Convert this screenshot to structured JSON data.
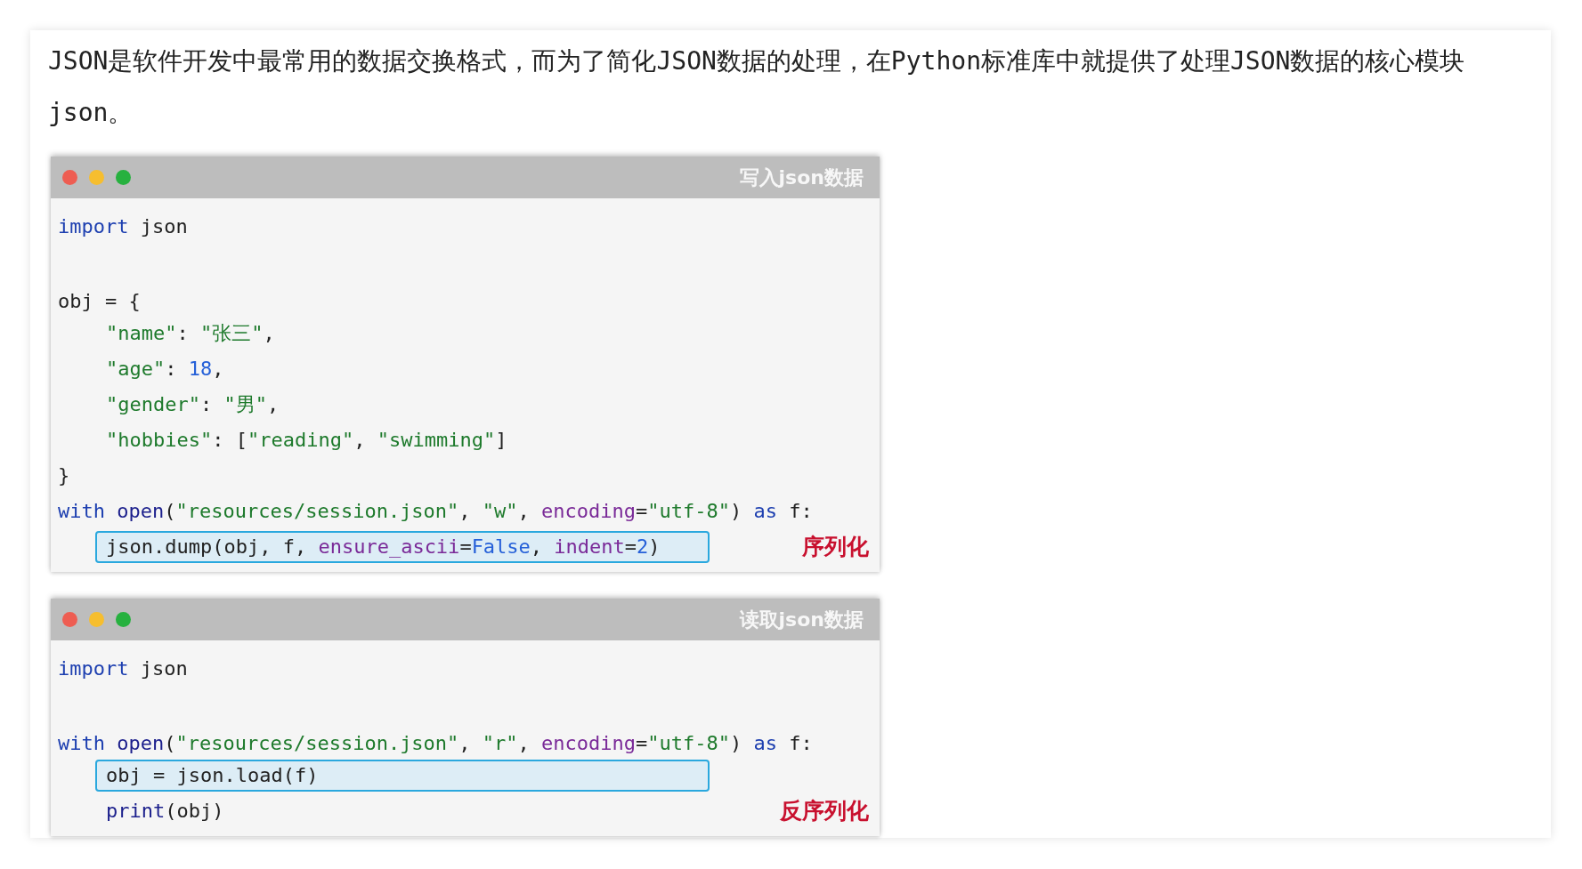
{
  "intro": "JSON是软件开发中最常用的数据交换格式，而为了简化JSON数据的处理，在Python标准库中就提供了处理JSON数据的核心模块 json。",
  "windows": [
    {
      "title": "写入json数据",
      "annotation": "序列化",
      "lines": [
        {
          "tokens": [
            {
              "t": "import",
              "kind": "kw"
            },
            {
              "t": " json",
              "kind": "plain"
            }
          ]
        },
        {
          "blank_before": true,
          "tokens": [
            {
              "t": "obj = {",
              "kind": "plain"
            }
          ]
        },
        {
          "indented": true,
          "tokens": [
            {
              "t": "\"name\"",
              "kind": "str"
            },
            {
              "t": ": ",
              "kind": "plain"
            },
            {
              "t": "\"张三\"",
              "kind": "str"
            },
            {
              "t": ",",
              "kind": "plain"
            }
          ]
        },
        {
          "indented": true,
          "tokens": [
            {
              "t": "\"age\"",
              "kind": "str"
            },
            {
              "t": ": ",
              "kind": "plain"
            },
            {
              "t": "18",
              "kind": "num"
            },
            {
              "t": ",",
              "kind": "plain"
            }
          ]
        },
        {
          "indented": true,
          "tokens": [
            {
              "t": "\"gender\"",
              "kind": "str"
            },
            {
              "t": ": ",
              "kind": "plain"
            },
            {
              "t": "\"男\"",
              "kind": "str"
            },
            {
              "t": ",",
              "kind": "plain"
            }
          ]
        },
        {
          "indented": true,
          "tokens": [
            {
              "t": "\"hobbies\"",
              "kind": "str"
            },
            {
              "t": ": [",
              "kind": "plain"
            },
            {
              "t": "\"reading\"",
              "kind": "str"
            },
            {
              "t": ", ",
              "kind": "plain"
            },
            {
              "t": "\"swimming\"",
              "kind": "str"
            },
            {
              "t": "]",
              "kind": "plain"
            }
          ]
        },
        {
          "tokens": [
            {
              "t": "}",
              "kind": "plain"
            }
          ]
        },
        {
          "tokens": [
            {
              "t": "with",
              "kind": "kw"
            },
            {
              "t": " open",
              "kind": "fn"
            },
            {
              "t": "(",
              "kind": "plain"
            },
            {
              "t": "\"resources/session.json\"",
              "kind": "str"
            },
            {
              "t": ", ",
              "kind": "plain"
            },
            {
              "t": "\"w\"",
              "kind": "str"
            },
            {
              "t": ", ",
              "kind": "plain"
            },
            {
              "t": "encoding",
              "kind": "param"
            },
            {
              "t": "=",
              "kind": "plain"
            },
            {
              "t": "\"utf-8\"",
              "kind": "str"
            },
            {
              "t": ") ",
              "kind": "plain"
            },
            {
              "t": "as",
              "kind": "kw"
            },
            {
              "t": " f:",
              "kind": "plain"
            }
          ]
        },
        {
          "highlighted": true,
          "tokens": [
            {
              "t": "json.dump(obj, f, ",
              "kind": "plain"
            },
            {
              "t": "ensure_ascii",
              "kind": "param"
            },
            {
              "t": "=",
              "kind": "plain"
            },
            {
              "t": "False",
              "kind": "num"
            },
            {
              "t": ", ",
              "kind": "plain"
            },
            {
              "t": "indent",
              "kind": "param"
            },
            {
              "t": "=",
              "kind": "plain"
            },
            {
              "t": "2",
              "kind": "num"
            },
            {
              "t": ")",
              "kind": "plain"
            }
          ]
        }
      ]
    },
    {
      "title": "读取json数据",
      "annotation": "反序列化",
      "lines": [
        {
          "tokens": [
            {
              "t": "import",
              "kind": "kw"
            },
            {
              "t": " json",
              "kind": "plain"
            }
          ]
        },
        {
          "blank_before": true,
          "tokens": [
            {
              "t": "with",
              "kind": "kw"
            },
            {
              "t": " open",
              "kind": "fn"
            },
            {
              "t": "(",
              "kind": "plain"
            },
            {
              "t": "\"resources/session.json\"",
              "kind": "str"
            },
            {
              "t": ", ",
              "kind": "plain"
            },
            {
              "t": "\"r\"",
              "kind": "str"
            },
            {
              "t": ", ",
              "kind": "plain"
            },
            {
              "t": "encoding",
              "kind": "param"
            },
            {
              "t": "=",
              "kind": "plain"
            },
            {
              "t": "\"utf-8\"",
              "kind": "str"
            },
            {
              "t": ") ",
              "kind": "plain"
            },
            {
              "t": "as",
              "kind": "kw"
            },
            {
              "t": " f:",
              "kind": "plain"
            }
          ]
        },
        {
          "highlighted": true,
          "tokens": [
            {
              "t": "obj = json.load(f)",
              "kind": "plain"
            }
          ]
        },
        {
          "indented": true,
          "tokens": [
            {
              "t": "print",
              "kind": "fn"
            },
            {
              "t": "(obj)",
              "kind": "plain"
            }
          ]
        }
      ]
    }
  ]
}
